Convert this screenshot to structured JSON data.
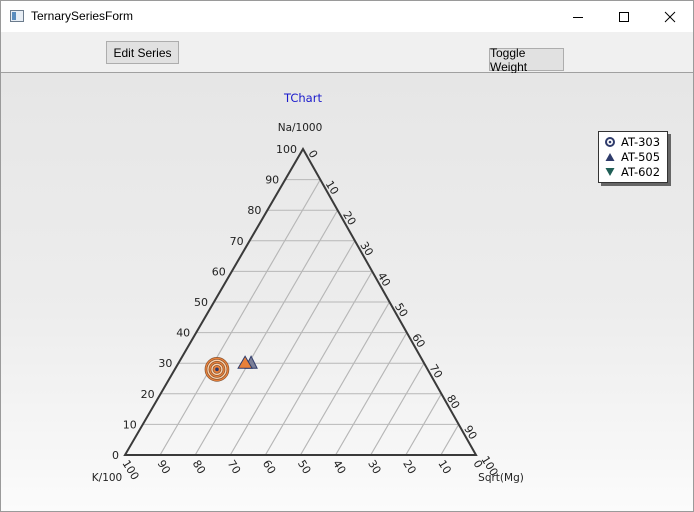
{
  "window": {
    "title": "TernarySeriesForm"
  },
  "toolbar": {
    "edit_series_label": "Edit Series",
    "toggle_weight_label": "Toggle Weight"
  },
  "icons": {
    "app": "app-window-icon",
    "minimize": "minimize-icon",
    "maximize": "maximize-icon",
    "close": "close-icon"
  },
  "chart_data": {
    "type": "ternary",
    "title": "TChart",
    "axes": {
      "top": {
        "label": "Na/1000",
        "ticks": [
          "0",
          "10",
          "20",
          "30",
          "40",
          "50",
          "60",
          "70",
          "80",
          "90",
          "100"
        ]
      },
      "left": {
        "label": "K/100",
        "ticks": [
          "0",
          "10",
          "20",
          "30",
          "40",
          "50",
          "60",
          "70",
          "80",
          "90",
          "100"
        ]
      },
      "right": {
        "label": "Sqrt(Mg)",
        "ticks": [
          "0",
          "10",
          "20",
          "30",
          "40",
          "50",
          "60",
          "70",
          "80",
          "90",
          "100"
        ]
      }
    },
    "grid": true,
    "legend_position": "top-right",
    "series": [
      {
        "name": "AT-303",
        "marker": "circle",
        "color": "#e8803a",
        "points": [
          {
            "na": 28,
            "k": 60,
            "mg": 12,
            "weight": 3
          }
        ]
      },
      {
        "name": "AT-505",
        "marker": "triangle-up",
        "color": "#2f3b6b",
        "points": [
          {
            "na": 30,
            "k": 51,
            "mg": 19,
            "weight": 1
          }
        ]
      },
      {
        "name": "AT-602",
        "marker": "triangle-down",
        "color": "#1f5e55",
        "points": []
      }
    ]
  }
}
